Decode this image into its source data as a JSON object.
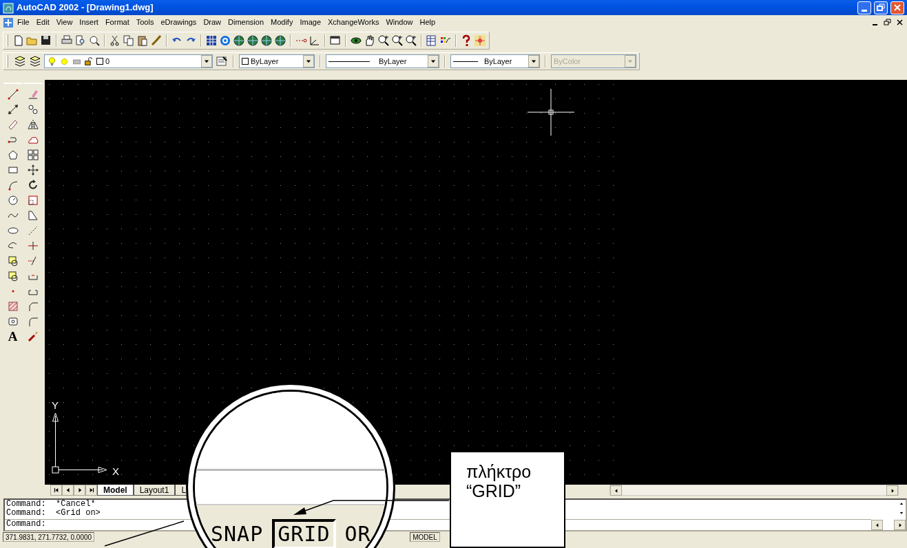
{
  "window": {
    "title": "AutoCAD 2002 - [Drawing1.dwg]"
  },
  "menu": [
    "File",
    "Edit",
    "View",
    "Insert",
    "Format",
    "Tools",
    "eDrawings",
    "Draw",
    "Dimension",
    "Modify",
    "Image",
    "XchangeWorks",
    "Window",
    "Help"
  ],
  "layers_toolbar": {
    "layer": "0",
    "color_setting": "ByLayer",
    "linetype": "ByLayer",
    "lineweight": "ByLayer",
    "plot_style": {
      "value": "ByColor",
      "disabled": true
    }
  },
  "draw_toolbar": {
    "text_tool_glyph": "A"
  },
  "drawing": {
    "grid_on": true,
    "axis_labels": {
      "y": "Y",
      "x": "X"
    }
  },
  "layout_tabs": [
    {
      "label": "Model",
      "selected": true
    },
    {
      "label": "Layout1",
      "selected": false
    },
    {
      "label": "L",
      "selected": false
    }
  ],
  "command_lines": [
    "Command:  *Cancel*",
    "Command:  <Grid on>"
  ],
  "command_prompt": "Command:",
  "status_bar": {
    "coordinates": "371.9831, 271.7732, 0.0000",
    "mode": "MODEL"
  },
  "magnifier": {
    "buttons": [
      {
        "label": "SNAP",
        "pressed": false
      },
      {
        "label": "GRID",
        "pressed": true
      },
      {
        "label": "OR",
        "pressed": false
      }
    ]
  },
  "callout": {
    "text": "πλήκτρο “GRID”"
  }
}
